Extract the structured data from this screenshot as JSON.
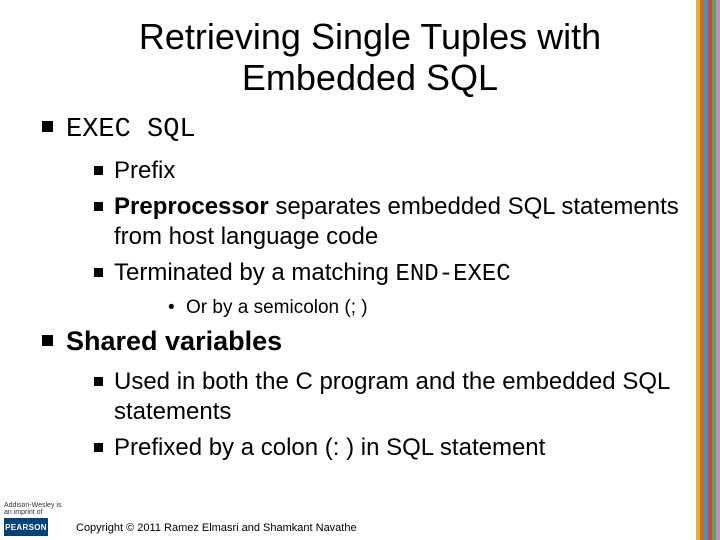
{
  "title": "Retrieving Single Tuples with Embedded SQL",
  "section1": {
    "heading": "EXEC SQL",
    "items": {
      "a": "Prefix",
      "b_bold": "Preprocessor",
      "b_rest": " separates embedded SQL statements from host language code",
      "c_pre": "Terminated by a matching ",
      "c_code": "END-EXEC",
      "sub": "Or by a semicolon (; )"
    }
  },
  "section2": {
    "heading": "Shared variables",
    "items": {
      "a": "Used in both the C program and the embedded SQL statements",
      "b": "Prefixed by a colon (: ) in SQL statement"
    }
  },
  "footer": "Copyright © 2011 Ramez Elmasri and Shamkant Navathe",
  "logo": {
    "top": "Addison-Wesley is an imprint of",
    "brand": "PEARSON"
  }
}
